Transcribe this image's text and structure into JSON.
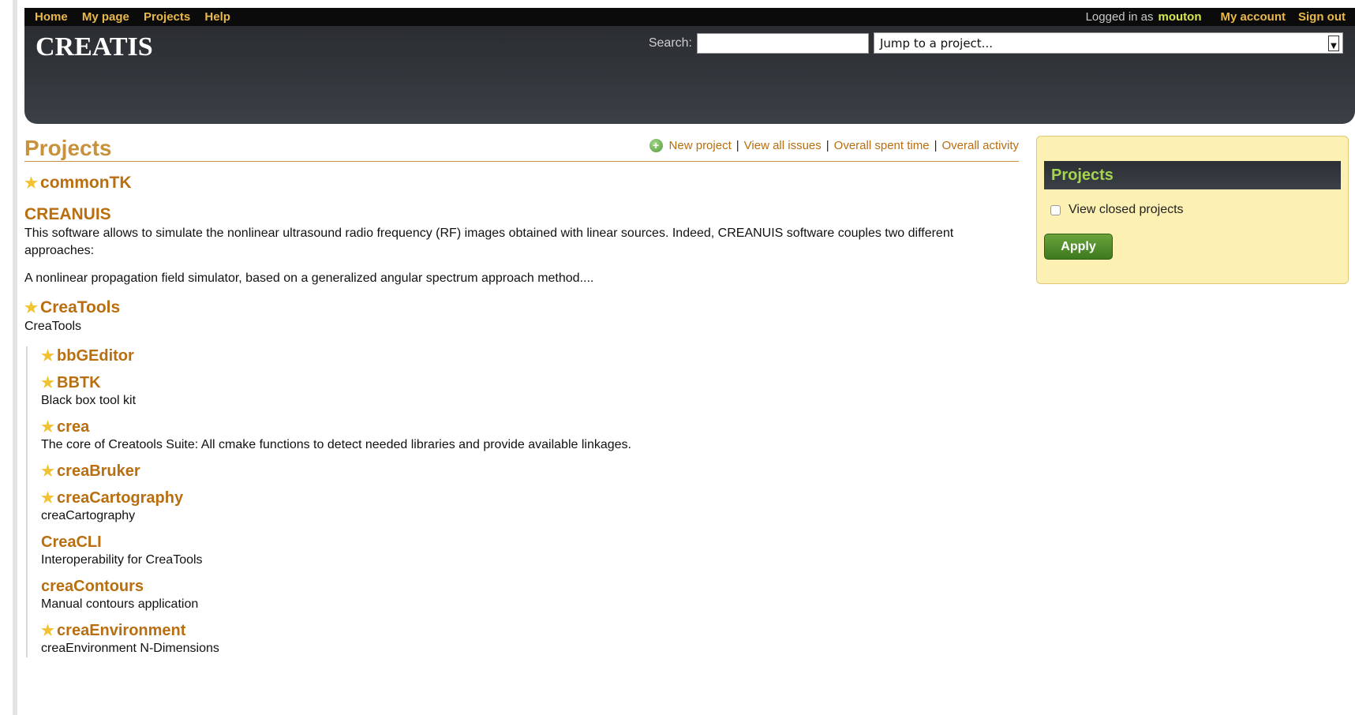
{
  "top_menu": {
    "left_links": [
      "Home",
      "My page",
      "Projects",
      "Help"
    ],
    "logged_in_label": "Logged in as",
    "username": "mouton",
    "my_account": "My account",
    "sign_out": "Sign out"
  },
  "header": {
    "site_title": "CREATIS",
    "search_label": "Search:",
    "search_value": "",
    "jump_select_value": "Jump to a project..."
  },
  "main": {
    "title": "Projects",
    "actions": {
      "new_project": "New project",
      "view_all_issues": "View all issues",
      "overall_spent_time": "Overall spent time",
      "overall_activity": "Overall activity",
      "separator": "|"
    },
    "projects": [
      {
        "name": "commonTK",
        "starred": true,
        "description": []
      },
      {
        "name": "CREANUIS",
        "starred": false,
        "description": [
          "This software allows to simulate the nonlinear ultrasound radio frequency (RF) images obtained with linear sources. Indeed, CREANUIS software couples two different approaches:",
          "A nonlinear propagation field simulator, based on a generalized angular spectrum approach method...."
        ]
      },
      {
        "name": "CreaTools",
        "starred": true,
        "description": [
          "CreaTools"
        ]
      }
    ],
    "subprojects": [
      {
        "name": "bbGEditor",
        "starred": true,
        "description": ""
      },
      {
        "name": "BBTK",
        "starred": true,
        "description": "Black box tool kit"
      },
      {
        "name": "crea",
        "starred": true,
        "description": "The core of Creatools Suite: All cmake functions to detect needed libraries and provide available linkages."
      },
      {
        "name": "creaBruker",
        "starred": true,
        "description": ""
      },
      {
        "name": "creaCartography",
        "starred": true,
        "description": "creaCartography"
      },
      {
        "name": "CreaCLI",
        "starred": false,
        "description": "Interoperability for CreaTools"
      },
      {
        "name": "creaContours",
        "starred": false,
        "description": "Manual contours application"
      },
      {
        "name": "creaEnvironment",
        "starred": true,
        "description": "creaEnvironment N-Dimensions"
      }
    ]
  },
  "sidebar": {
    "title": "Projects",
    "view_closed_label": "View closed projects",
    "view_closed_checked": false,
    "apply_label": "Apply"
  },
  "icons": {
    "star": "star-icon",
    "new_project": "plus-circle-icon",
    "dropdown": "chevron-down-icon"
  },
  "colors": {
    "accent": "#c8913c",
    "link": "#b96e10",
    "header_bg": "#2c3035",
    "sidebar_bg": "#fcf0b3",
    "apply_bg": "#4f8a2a"
  }
}
